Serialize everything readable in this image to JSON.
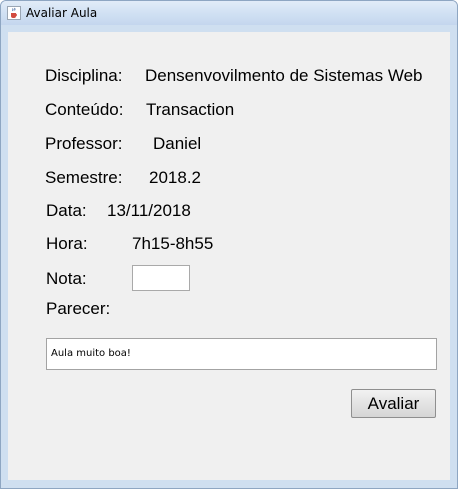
{
  "window": {
    "title": "Avaliar Aula"
  },
  "form": {
    "disciplina_label": "Disciplina:",
    "disciplina_value": "Densenvovilmento de Sistemas Web",
    "conteudo_label": "Conteúdo:",
    "conteudo_value": "Transaction",
    "professor_label": "Professor:",
    "professor_value": "Daniel",
    "semestre_label": "Semestre:",
    "semestre_value": "2018.2",
    "data_label": "Data:",
    "data_value": "13/11/2018",
    "hora_label": "Hora:",
    "hora_value": "7h15-8h55",
    "nota_label": "Nota:",
    "nota_value": "",
    "parecer_label": "Parecer:",
    "parecer_value": "Aula muito boa!"
  },
  "actions": {
    "avaliar_label": "Avaliar"
  },
  "icons": {
    "app": "java-coffee-icon"
  }
}
